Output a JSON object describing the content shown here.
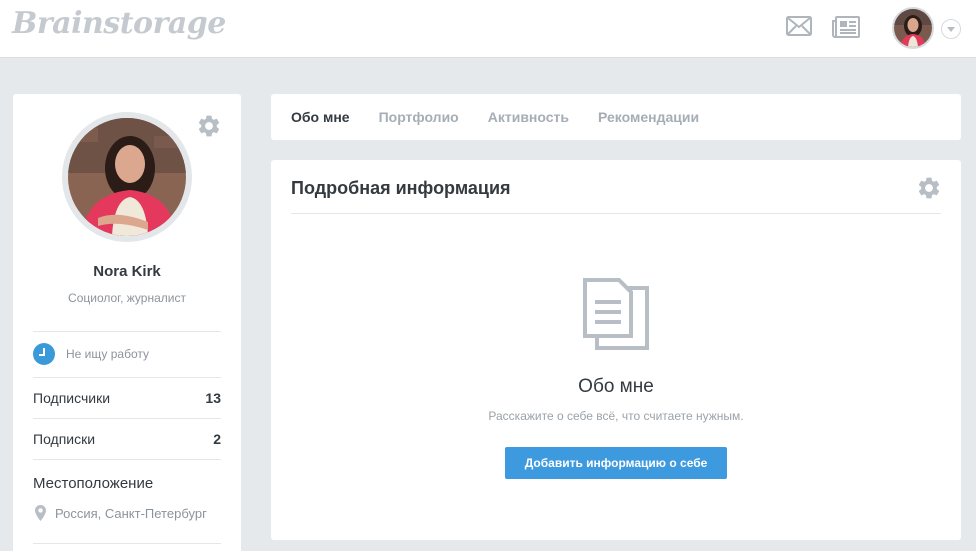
{
  "header": {
    "logo_text": "Brainstorage",
    "icons": [
      "mail-icon",
      "newspaper-icon",
      "chevron-down-icon"
    ]
  },
  "profile": {
    "name": "Nora Kirk",
    "role": "Социолог, журналист",
    "job_status": "Не ищу работу",
    "stats": [
      {
        "label": "Подписчики",
        "count": "13"
      },
      {
        "label": "Подписки",
        "count": "2"
      }
    ],
    "location_title": "Местоположение",
    "location": "Россия, Санкт-Петербург"
  },
  "tabs": [
    {
      "label": "Обо мне",
      "active": true
    },
    {
      "label": "Портфолио",
      "active": false
    },
    {
      "label": "Активность",
      "active": false
    },
    {
      "label": "Рекомендации",
      "active": false
    }
  ],
  "details": {
    "title": "Подробная информация",
    "empty_title": "Обо мне",
    "empty_subtitle": "Расскажите о себе всё, что считаете нужным.",
    "add_button": "Добавить информацию о себе"
  },
  "colors": {
    "accent": "#3d9ade",
    "background": "#e6e9ec",
    "muted_text": "#8b949c"
  }
}
